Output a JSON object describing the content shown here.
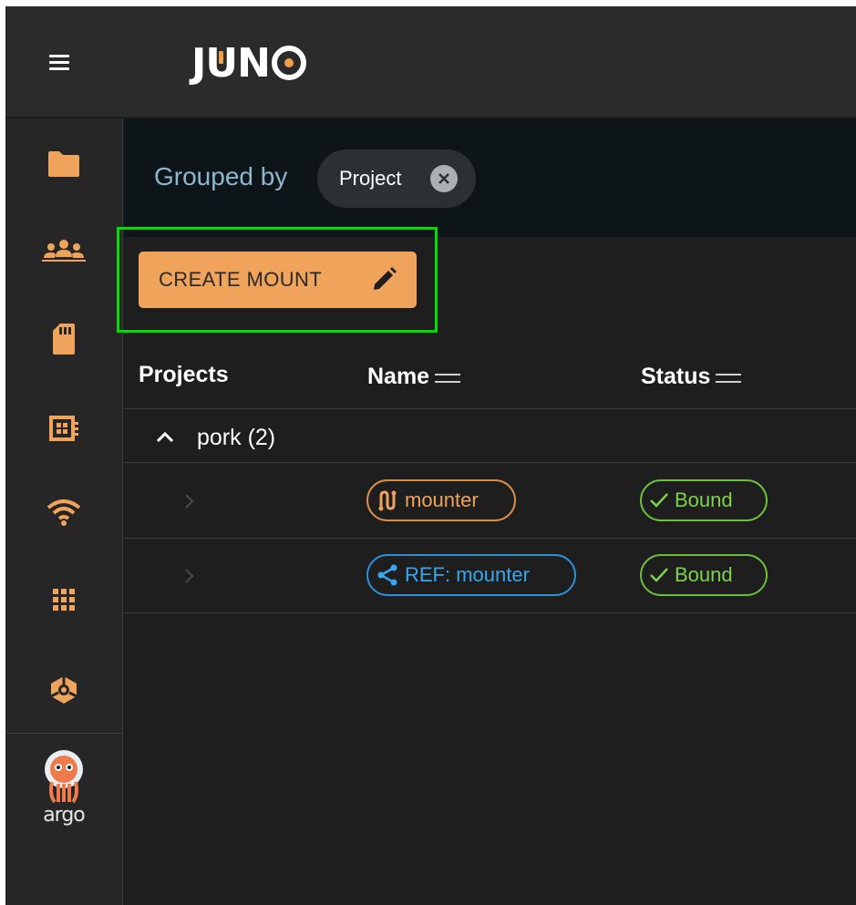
{
  "app": {
    "logo_text": "JUNO"
  },
  "sidebar": {
    "items": [
      {
        "icon": "folder-icon"
      },
      {
        "icon": "people-icon"
      },
      {
        "icon": "sd-card-icon"
      },
      {
        "icon": "dashboard-icon"
      },
      {
        "icon": "wifi-icon"
      },
      {
        "icon": "apps-grid-icon"
      },
      {
        "icon": "cube-icon"
      }
    ],
    "argo": {
      "icon": "argo-logo-icon",
      "label": "argo"
    }
  },
  "group_bar": {
    "label": "Grouped by",
    "chip_label": "Project"
  },
  "toolbar": {
    "create_label": "CREATE MOUNT"
  },
  "table": {
    "columns": [
      "Projects",
      "Name",
      "Status"
    ],
    "group": {
      "name": "pork (2)"
    },
    "rows": [
      {
        "name": "mounter",
        "name_icon": "mount-icon",
        "name_color": "#f0a35a",
        "status": "Bound",
        "status_color": "#7fd34a"
      },
      {
        "name": "REF: mounter",
        "name_icon": "share-icon",
        "name_color": "#3aa6f0",
        "status": "Bound",
        "status_color": "#7fd34a"
      }
    ]
  },
  "colors": {
    "accent": "#f0a35a",
    "highlight": "#00e000",
    "ref": "#3aa6f0",
    "bound": "#7fd34a"
  }
}
